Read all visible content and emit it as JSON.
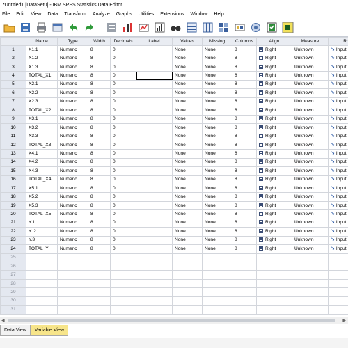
{
  "window": {
    "title": "*Untitled1 [DataSet0] - IBM SPSS Statistics Data Editor"
  },
  "menu": [
    "File",
    "Edit",
    "View",
    "Data",
    "Transform",
    "Analyze",
    "Graphs",
    "Utilities",
    "Extensions",
    "Window",
    "Help"
  ],
  "toolbar": {
    "icons": [
      "open-folder-icon",
      "save-icon",
      "print-icon",
      "recall-dialog-icon",
      "undo-icon",
      "redo-icon",
      "goto-case-icon",
      "goto-variable-icon",
      "variables-icon",
      "run-descriptives-icon",
      "find-icon",
      "insert-cases-icon",
      "insert-variable-icon",
      "split-file-icon",
      "weight-cases-icon",
      "select-cases-icon",
      "value-labels-icon",
      "use-sets-icon"
    ]
  },
  "grid": {
    "columns": [
      "",
      "Name",
      "Type",
      "Width",
      "Decimals",
      "Label",
      "Values",
      "Missing",
      "Columns",
      "Align",
      "Measure",
      "Role"
    ],
    "rows": [
      {
        "n": "1",
        "name": "X1.1",
        "type": "Numeric",
        "width": "8",
        "decimals": "0",
        "label": "",
        "values": "None",
        "missing": "None",
        "columns": "8",
        "align": "Right",
        "measure": "Unknown",
        "role": "Input"
      },
      {
        "n": "2",
        "name": "X1.2",
        "type": "Numeric",
        "width": "8",
        "decimals": "0",
        "label": "",
        "values": "None",
        "missing": "None",
        "columns": "8",
        "align": "Right",
        "measure": "Unknown",
        "role": "Input"
      },
      {
        "n": "3",
        "name": "X1.3",
        "type": "Numeric",
        "width": "8",
        "decimals": "0",
        "label": "",
        "values": "None",
        "missing": "None",
        "columns": "8",
        "align": "Right",
        "measure": "Unknown",
        "role": "Input"
      },
      {
        "n": "4",
        "name": "TOTAL_X1",
        "type": "Numeric",
        "width": "8",
        "decimals": "0",
        "label": "",
        "values": "None",
        "missing": "None",
        "columns": "8",
        "align": "Right",
        "measure": "Unknown",
        "role": "Input"
      },
      {
        "n": "5",
        "name": "X2.1",
        "type": "Numeric",
        "width": "8",
        "decimals": "0",
        "label": "",
        "values": "None",
        "missing": "None",
        "columns": "8",
        "align": "Right",
        "measure": "Unknown",
        "role": "Input"
      },
      {
        "n": "6",
        "name": "X2.2",
        "type": "Numeric",
        "width": "8",
        "decimals": "0",
        "label": "",
        "values": "None",
        "missing": "None",
        "columns": "8",
        "align": "Right",
        "measure": "Unknown",
        "role": "Input"
      },
      {
        "n": "7",
        "name": "X2.3",
        "type": "Numeric",
        "width": "8",
        "decimals": "0",
        "label": "",
        "values": "None",
        "missing": "None",
        "columns": "8",
        "align": "Right",
        "measure": "Unknown",
        "role": "Input"
      },
      {
        "n": "8",
        "name": "TOTAL_X2",
        "type": "Numeric",
        "width": "8",
        "decimals": "0",
        "label": "",
        "values": "None",
        "missing": "None",
        "columns": "8",
        "align": "Right",
        "measure": "Unknown",
        "role": "Input"
      },
      {
        "n": "9",
        "name": "X3.1",
        "type": "Numeric",
        "width": "8",
        "decimals": "0",
        "label": "",
        "values": "None",
        "missing": "None",
        "columns": "8",
        "align": "Right",
        "measure": "Unknown",
        "role": "Input"
      },
      {
        "n": "10",
        "name": "X3.2",
        "type": "Numeric",
        "width": "8",
        "decimals": "0",
        "label": "",
        "values": "None",
        "missing": "None",
        "columns": "8",
        "align": "Right",
        "measure": "Unknown",
        "role": "Input"
      },
      {
        "n": "11",
        "name": "X3.3",
        "type": "Numeric",
        "width": "8",
        "decimals": "0",
        "label": "",
        "values": "None",
        "missing": "None",
        "columns": "8",
        "align": "Right",
        "measure": "Unknown",
        "role": "Input"
      },
      {
        "n": "12",
        "name": "TOTAL_X3",
        "type": "Numeric",
        "width": "8",
        "decimals": "0",
        "label": "",
        "values": "None",
        "missing": "None",
        "columns": "8",
        "align": "Right",
        "measure": "Unknown",
        "role": "Input"
      },
      {
        "n": "13",
        "name": "X4.1",
        "type": "Numeric",
        "width": "8",
        "decimals": "0",
        "label": "",
        "values": "None",
        "missing": "None",
        "columns": "8",
        "align": "Right",
        "measure": "Unknown",
        "role": "Input"
      },
      {
        "n": "14",
        "name": "X4.2",
        "type": "Numeric",
        "width": "8",
        "decimals": "0",
        "label": "",
        "values": "None",
        "missing": "None",
        "columns": "8",
        "align": "Right",
        "measure": "Unknown",
        "role": "Input"
      },
      {
        "n": "15",
        "name": "X4.3",
        "type": "Numeric",
        "width": "8",
        "decimals": "0",
        "label": "",
        "values": "None",
        "missing": "None",
        "columns": "8",
        "align": "Right",
        "measure": "Unknown",
        "role": "Input"
      },
      {
        "n": "16",
        "name": "TOTAL_X4",
        "type": "Numeric",
        "width": "8",
        "decimals": "0",
        "label": "",
        "values": "None",
        "missing": "None",
        "columns": "8",
        "align": "Right",
        "measure": "Unknown",
        "role": "Input"
      },
      {
        "n": "17",
        "name": "X5.1",
        "type": "Numeric",
        "width": "8",
        "decimals": "0",
        "label": "",
        "values": "None",
        "missing": "None",
        "columns": "8",
        "align": "Right",
        "measure": "Unknown",
        "role": "Input"
      },
      {
        "n": "18",
        "name": "X5.2",
        "type": "Numeric",
        "width": "8",
        "decimals": "0",
        "label": "",
        "values": "None",
        "missing": "None",
        "columns": "8",
        "align": "Right",
        "measure": "Unknown",
        "role": "Input"
      },
      {
        "n": "19",
        "name": "X5.3",
        "type": "Numeric",
        "width": "8",
        "decimals": "0",
        "label": "",
        "values": "None",
        "missing": "None",
        "columns": "8",
        "align": "Right",
        "measure": "Unknown",
        "role": "Input"
      },
      {
        "n": "20",
        "name": "TOTAL_X5",
        "type": "Numeric",
        "width": "8",
        "decimals": "0",
        "label": "",
        "values": "None",
        "missing": "None",
        "columns": "8",
        "align": "Right",
        "measure": "Unknown",
        "role": "Input"
      },
      {
        "n": "21",
        "name": "Y.1",
        "type": "Numeric",
        "width": "8",
        "decimals": "0",
        "label": "",
        "values": "None",
        "missing": "None",
        "columns": "8",
        "align": "Right",
        "measure": "Unknown",
        "role": "Input"
      },
      {
        "n": "22",
        "name": "Y..2",
        "type": "Numeric",
        "width": "8",
        "decimals": "0",
        "label": "",
        "values": "None",
        "missing": "None",
        "columns": "8",
        "align": "Right",
        "measure": "Unknown",
        "role": "Input"
      },
      {
        "n": "23",
        "name": "Y.3",
        "type": "Numeric",
        "width": "8",
        "decimals": "0",
        "label": "",
        "values": "None",
        "missing": "None",
        "columns": "8",
        "align": "Right",
        "measure": "Unknown",
        "role": "Input"
      },
      {
        "n": "24",
        "name": "TOTAL_Y",
        "type": "Numeric",
        "width": "8",
        "decimals": "0",
        "label": "",
        "values": "None",
        "missing": "None",
        "columns": "8",
        "align": "Right",
        "measure": "Unknown",
        "role": "Input"
      }
    ],
    "empty_rows": [
      "25",
      "26",
      "27",
      "28",
      "29",
      "30",
      "31"
    ],
    "selected_cell": {
      "row": 4,
      "column": "Label"
    }
  },
  "tabs": [
    {
      "label": "Data View",
      "active": false
    },
    {
      "label": "Variable View",
      "active": true
    }
  ],
  "colors": {
    "active_tab": "#f7e58a",
    "header_bg": "#e9ecf2",
    "rownum_bg": "#e4e8f0"
  }
}
